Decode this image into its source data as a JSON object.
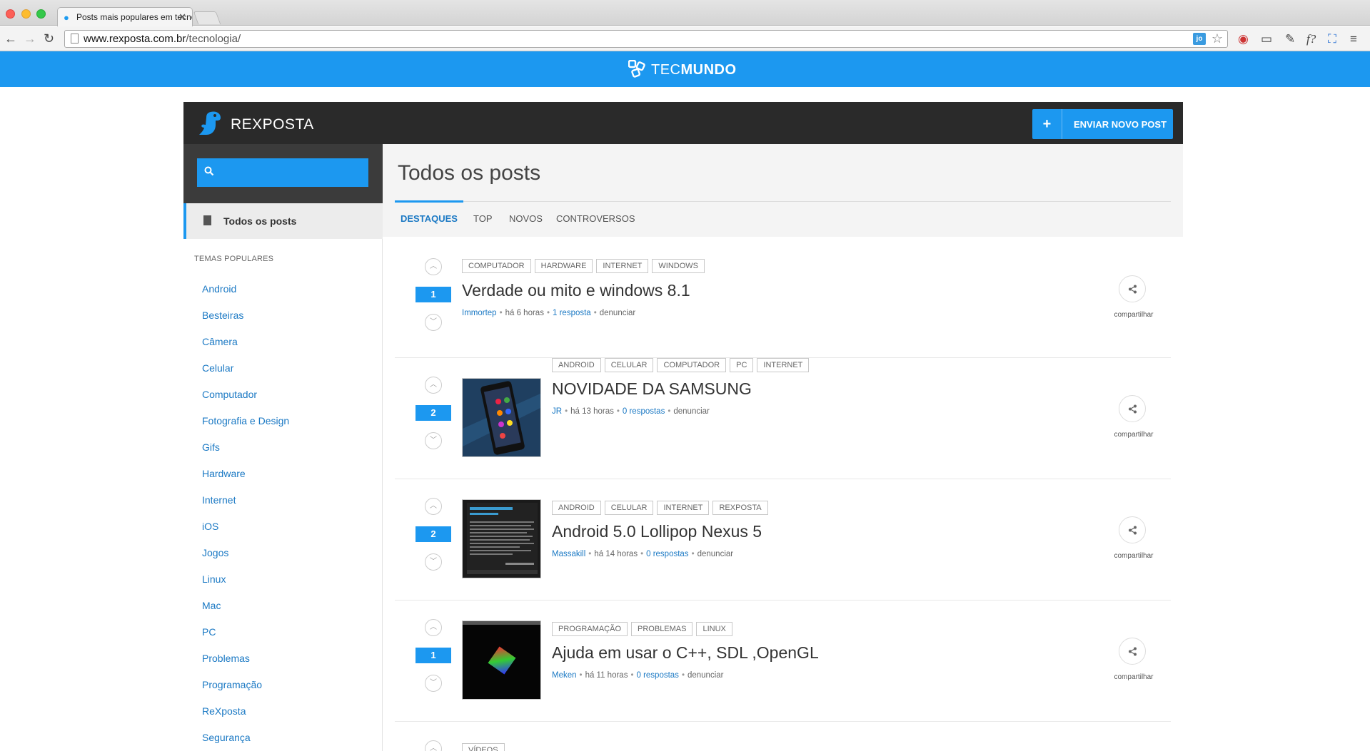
{
  "browser": {
    "tab_title": "Posts mais populares em tecnologia",
    "url_host": "www.rexposta.com.br",
    "url_path": "/tecnologia/",
    "ext_jo": "jo"
  },
  "site": {
    "brand_light": "TEC",
    "brand_bold": "MUNDO",
    "app_name": "REXPOSTA",
    "send_button": "ENVIAR NOVO POST",
    "send_plus": "+"
  },
  "sidebar": {
    "search_placeholder": "",
    "all_posts": "Todos os posts",
    "popular_title": "TEMAS POPULARES",
    "topics": [
      "Android",
      "Besteiras",
      "Câmera",
      "Celular",
      "Computador",
      "Fotografia e Design",
      "Gifs",
      "Hardware",
      "Internet",
      "iOS",
      "Jogos",
      "Linux",
      "Mac",
      "PC",
      "Problemas",
      "Programação",
      "ReXposta",
      "Segurança"
    ]
  },
  "main": {
    "title": "Todos os posts",
    "tabs": [
      "DESTAQUES",
      "TOP",
      "NOVOS",
      "CONTROVERSOS"
    ],
    "share_label": "compartilhar",
    "posts": [
      {
        "votes": "1",
        "tags": [
          "COMPUTADOR",
          "HARDWARE",
          "INTERNET",
          "WINDOWS"
        ],
        "title": "Verdade ou mito e windows 8.1",
        "author": "Immortep",
        "time": "há 6 horas",
        "answers": "1 resposta",
        "report": "denunciar"
      },
      {
        "votes": "2",
        "tags": [
          "ANDROID",
          "CELULAR",
          "COMPUTADOR",
          "PC",
          "INTERNET"
        ],
        "title": "NOVIDADE DA SAMSUNG",
        "author": "JR",
        "time": "há 13 horas",
        "answers": "0 respostas",
        "report": "denunciar"
      },
      {
        "votes": "2",
        "tags": [
          "ANDROID",
          "CELULAR",
          "INTERNET",
          "REXPOSTA"
        ],
        "title": "Android 5.0 Lollipop Nexus 5",
        "author": "Massakill",
        "time": "há 14 horas",
        "answers": "0 respostas",
        "report": "denunciar"
      },
      {
        "votes": "1",
        "tags": [
          "PROGRAMAÇÃO",
          "PROBLEMAS",
          "LINUX"
        ],
        "title": "Ajuda em usar o C++, SDL ,OpenGL",
        "author": "Meken",
        "time": "há 11 horas",
        "answers": "0 respostas",
        "report": "denunciar"
      },
      {
        "tags": [
          "VÍDEOS"
        ]
      }
    ]
  }
}
